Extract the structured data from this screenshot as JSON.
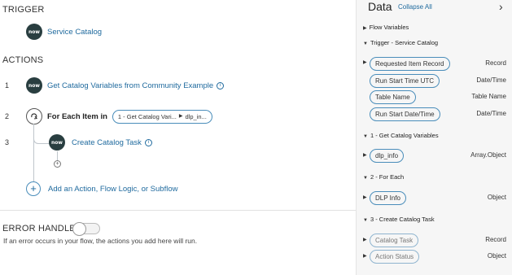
{
  "trigger": {
    "heading": "TRIGGER",
    "icon_text": "now",
    "label": "Service Catalog"
  },
  "actions": {
    "heading": "ACTIONS",
    "items": [
      {
        "num": "1",
        "icon_text": "now",
        "label": "Get Catalog Variables from Community Example",
        "info": "i"
      },
      {
        "num": "2",
        "prefix": "For Each Item in",
        "pill_a": "1 - Get Catalog Vari...",
        "pill_b": "dlp_in..."
      },
      {
        "num": "3",
        "icon_text": "now",
        "label": "Create Catalog Task",
        "info": "i"
      }
    ],
    "add_small": "+",
    "add_icon": "+",
    "add_label": "Add an Action, Flow Logic, or Subflow"
  },
  "error_handler": {
    "heading": "ERROR HANDLER",
    "description": "If an error occurs in your flow, the actions you add here will run.",
    "enabled": false
  },
  "panel": {
    "title": "Data",
    "collapse": "Collapse All",
    "close_icon": "›",
    "groups": [
      {
        "label": "Flow Variables",
        "expanded": false,
        "items": []
      },
      {
        "label": "Trigger - Service Catalog",
        "expanded": true,
        "items": [
          {
            "pill": "Requested Item Record",
            "type": "Record",
            "expandable": true
          },
          {
            "pill": "Run Start Time UTC",
            "type": "Date/Time",
            "expandable": false
          },
          {
            "pill": "Table Name",
            "type": "Table Name",
            "expandable": false
          },
          {
            "pill": "Run Start Date/Time",
            "type": "Date/Time",
            "expandable": false
          }
        ]
      },
      {
        "label": "1 - Get Catalog Variables",
        "expanded": true,
        "items": [
          {
            "pill": "dlp_info",
            "type": "Array.Object",
            "expandable": true
          }
        ]
      },
      {
        "label": "2 - For Each",
        "expanded": true,
        "items": [
          {
            "pill": "DLP Info",
            "type": "Object",
            "expandable": true
          }
        ]
      },
      {
        "label": "3 - Create Catalog Task",
        "expanded": true,
        "items": [
          {
            "pill": "Catalog Task",
            "type": "Record",
            "expandable": true
          },
          {
            "pill": "Action Status",
            "type": "Object",
            "expandable": true
          }
        ]
      }
    ]
  },
  "colors": {
    "accent": "#1f6a9e",
    "now_badge": "#293e40",
    "pill_border": "#4a8dba"
  }
}
